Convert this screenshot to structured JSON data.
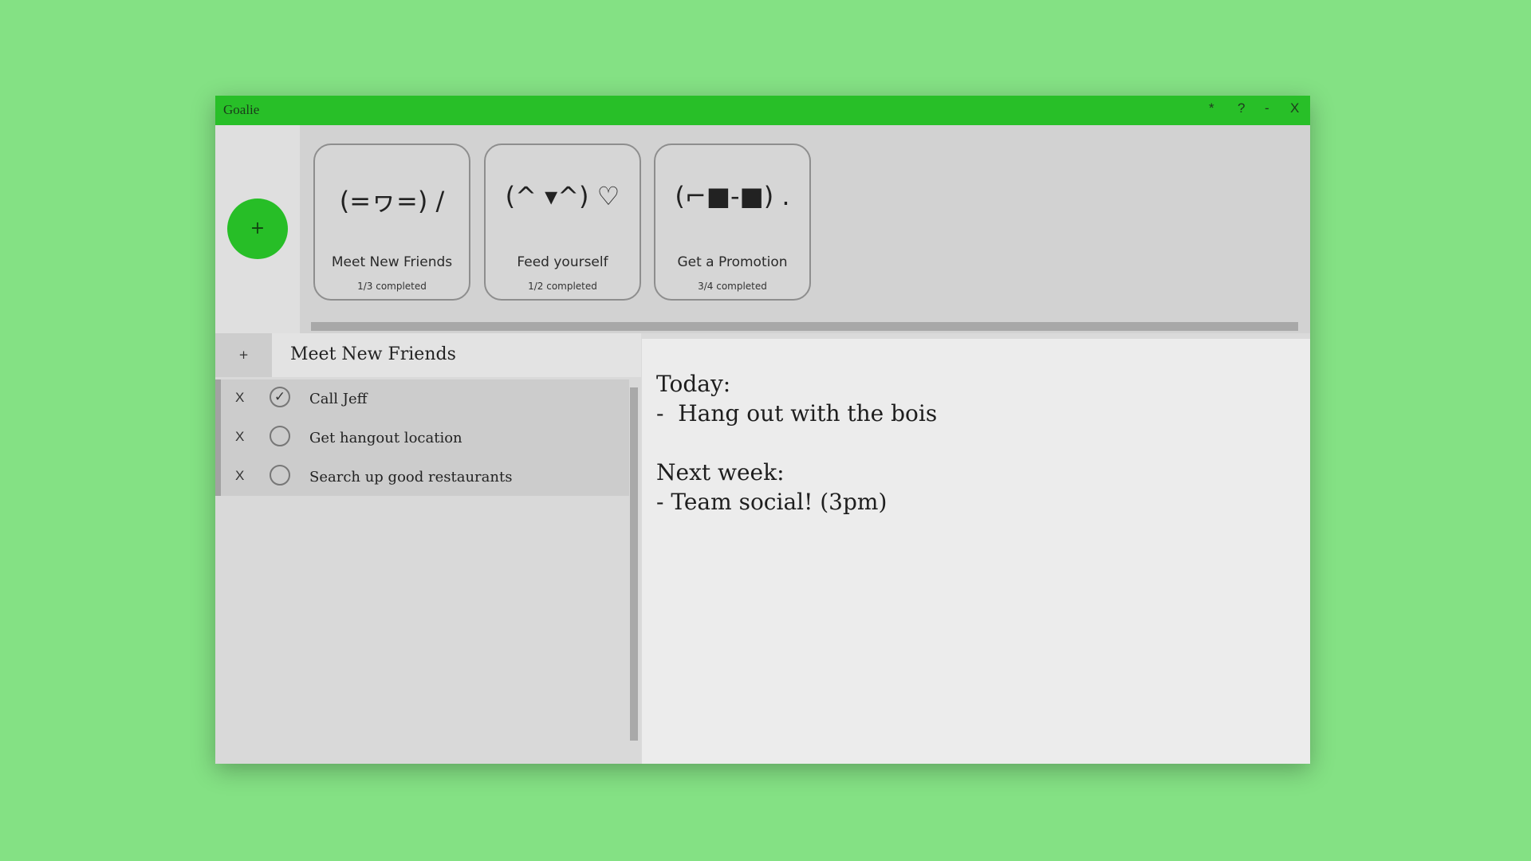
{
  "window": {
    "title": "Goalie",
    "controls": {
      "pin": "*",
      "help": "?",
      "minimize": "-",
      "close": "X"
    }
  },
  "goals": {
    "add_label": "+",
    "cards": [
      {
        "face": "(=ヮ=) /",
        "name": "Meet New Friends",
        "progress": "1/3 completed"
      },
      {
        "face": "(^ ▾^) ♡",
        "name": "Feed yourself",
        "progress": "1/2 completed"
      },
      {
        "face": "(⌐■-■) .",
        "name": "Get a Promotion",
        "progress": "3/4 completed"
      }
    ]
  },
  "task_list": {
    "add_label": "+",
    "title": "Meet New Friends",
    "delete_label": "X",
    "tasks": [
      {
        "label": "Call Jeff",
        "done": true,
        "check_mark": "✓"
      },
      {
        "label": "Get hangout location",
        "done": false,
        "check_mark": ""
      },
      {
        "label": "Search up good restaurants",
        "done": false,
        "check_mark": ""
      }
    ]
  },
  "notes": {
    "text": "Today:\n-  Hang out with the bois\n\nNext week:\n- Team social! (3pm)"
  },
  "colors": {
    "background": "#84e184",
    "accent": "#28bf28",
    "fab": "#27be27"
  }
}
